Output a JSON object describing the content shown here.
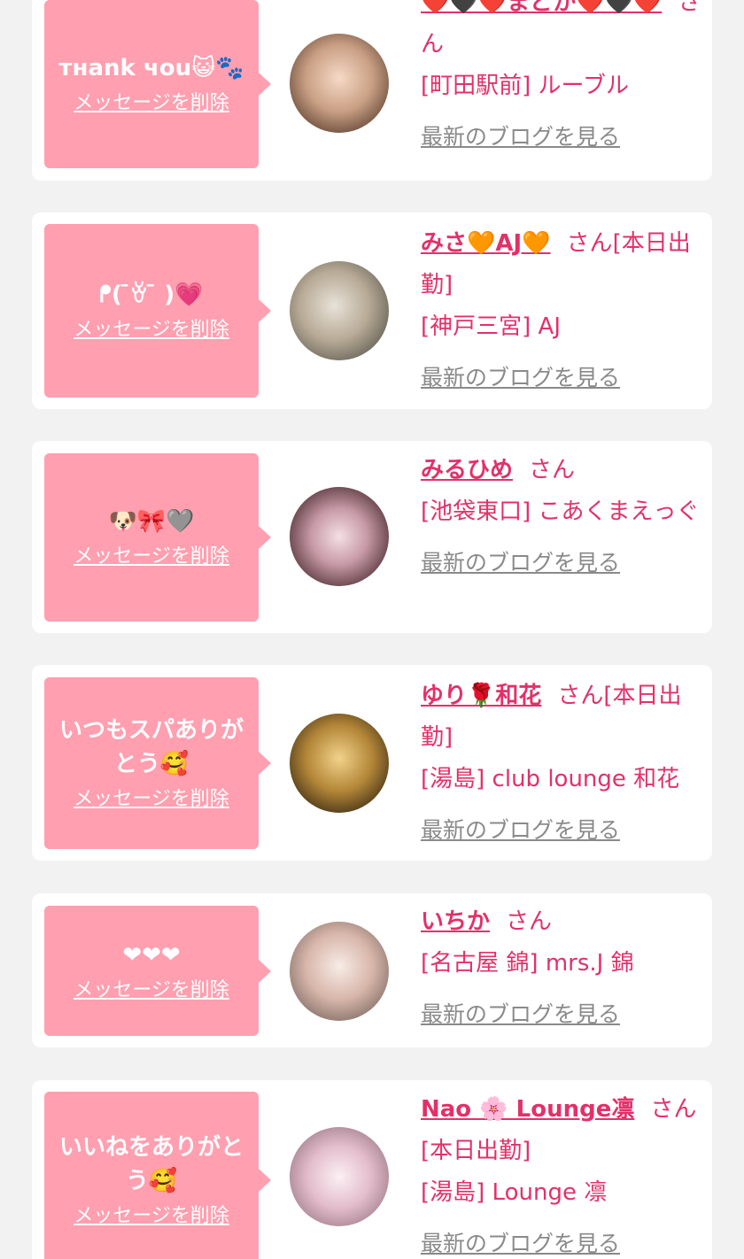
{
  "delete_label": "メッセージを削除",
  "blog_label": "最新のブログを見る",
  "colors": {
    "background": "#f2f2f2",
    "card": "#ffffff",
    "bubble": "#ff9fb0",
    "accent": "#e2316a",
    "link_gray": "#8a8a8a"
  },
  "items": [
    {
      "message": "тнank чou😺🐾",
      "name": "❤️🖤❤️まどか❤️🖤❤️",
      "suffix": "さん",
      "status": "",
      "shop": "[町田駅前] ルーブル"
    },
    {
      "message": "ᖰ(  ̄ꈊ ̄ )💗",
      "name": "みさ🧡AJ🧡",
      "suffix": "さん",
      "status": "[本日出勤]",
      "shop": "[神戸三宮] AJ"
    },
    {
      "message": "🐶🎀🩶",
      "name": "みるひめ",
      "suffix": "さん",
      "status": "",
      "shop": "[池袋東口] こあくまえっぐ"
    },
    {
      "message": "いつもスパありがとう🥰",
      "name": "ゆり🌹和花",
      "suffix": "さん",
      "status": "[本日出勤]",
      "shop": "[湯島] club lounge 和花"
    },
    {
      "message": "❤︎❤︎❤︎",
      "name": "いちか",
      "suffix": "さん",
      "status": "",
      "shop": "[名古屋 錦] mrs.J 錦"
    },
    {
      "message": "いいねをありがとう🥰",
      "name": "Nao 🌸 Lounge凛",
      "suffix": "さん",
      "status": "[本日出勤]",
      "shop": "[湯島] Lounge 凛"
    }
  ]
}
